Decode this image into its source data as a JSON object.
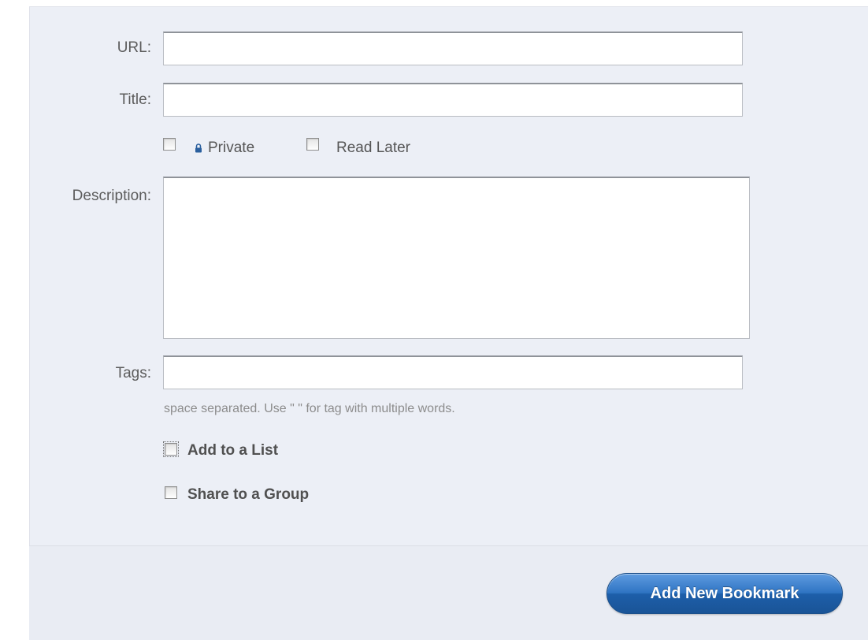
{
  "form": {
    "url_label": "URL:",
    "url_value": "",
    "title_label": "Title:",
    "title_value": "",
    "private_label": "Private",
    "private_icon": "lock-icon",
    "private_checked": false,
    "read_later_label": "Read Later",
    "read_later_checked": false,
    "description_label": "Description:",
    "description_value": "",
    "tags_label": "Tags:",
    "tags_value": "",
    "tags_hint": "space separated. Use \" \" for tag with multiple words.",
    "add_to_list_label": "Add to a List",
    "add_to_list_checked": false,
    "share_to_group_label": "Share to a Group",
    "share_to_group_checked": false
  },
  "footer": {
    "submit_label": "Add New Bookmark"
  },
  "colors": {
    "panel_bg": "#eceff6",
    "label_text": "#5c5c5c",
    "hint_text": "#8c8c8c",
    "button_blue": "#2f74c3"
  }
}
